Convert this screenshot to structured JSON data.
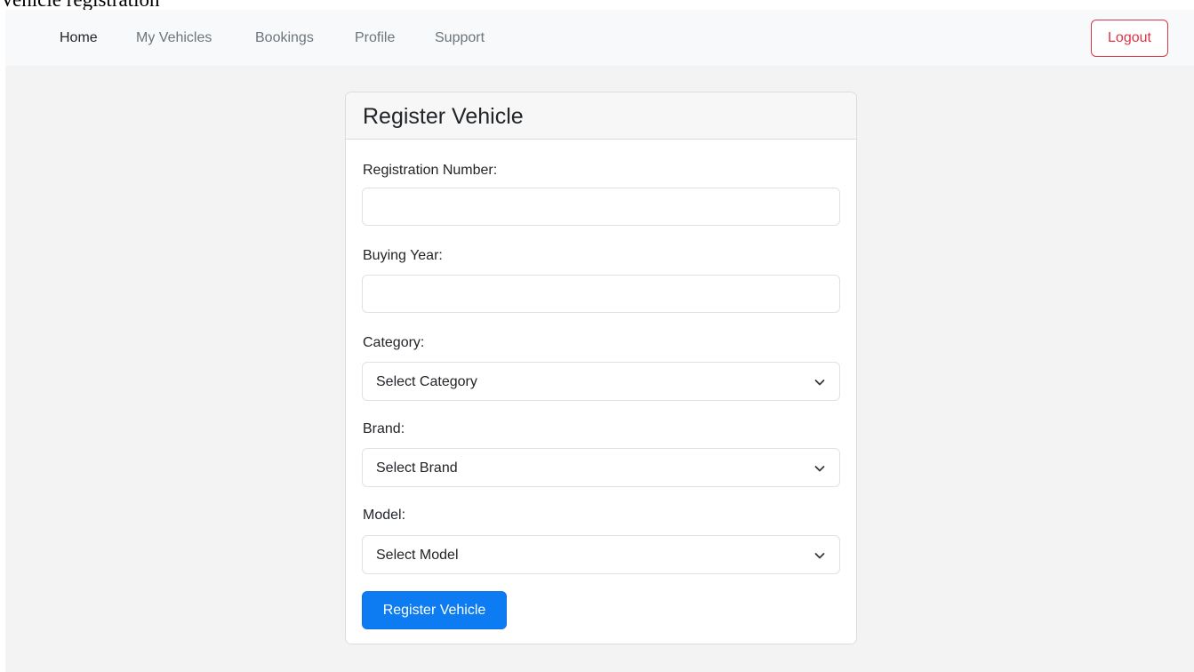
{
  "page": {
    "caption": "Vehicle registration"
  },
  "nav": {
    "items": [
      {
        "label": "Home",
        "active": true
      },
      {
        "label": "My Vehicles",
        "active": false
      },
      {
        "label": "Bookings",
        "active": false
      },
      {
        "label": "Profile",
        "active": false
      },
      {
        "label": "Support",
        "active": false
      }
    ],
    "logout_label": "Logout"
  },
  "form": {
    "title": "Register Vehicle",
    "registration_number": {
      "label": "Registration Number:",
      "value": ""
    },
    "buying_year": {
      "label": "Buying Year:",
      "value": ""
    },
    "category": {
      "label": "Category:",
      "selected": "Select Category",
      "icon": "chevron-down-icon"
    },
    "brand": {
      "label": "Brand:",
      "selected": "Select Brand",
      "icon": "chevron-down-icon"
    },
    "model": {
      "label": "Model:",
      "selected": "Select Model",
      "icon": "chevron-down-icon"
    },
    "submit_label": "Register Vehicle"
  },
  "colors": {
    "primary": "#0d7cf2",
    "danger": "#dc3545",
    "page_background": "#f3f3f3",
    "navbar_background": "#f8f9fa"
  }
}
